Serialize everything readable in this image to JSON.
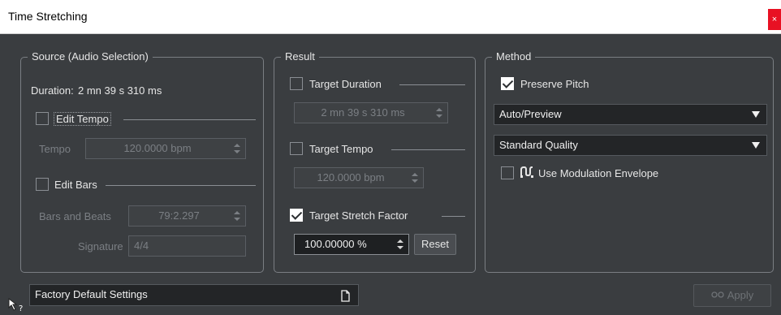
{
  "window": {
    "title": "Time Stretching",
    "close_label": "×"
  },
  "source": {
    "legend": "Source (Audio Selection)",
    "duration_label": "Duration:",
    "duration_value": "2 mn 39 s 310 ms",
    "edit_tempo": {
      "label": "Edit Tempo",
      "checked": false
    },
    "tempo": {
      "label": "Tempo",
      "value": "120.0000 bpm"
    },
    "edit_bars": {
      "label": "Edit Bars",
      "checked": false
    },
    "bars_and_beats": {
      "label": "Bars and Beats",
      "value": "79:2.297"
    },
    "signature": {
      "label": "Signature",
      "value": "4/4"
    }
  },
  "result": {
    "legend": "Result",
    "target_duration": {
      "label": "Target Duration",
      "checked": false,
      "value": "2 mn 39 s 310 ms"
    },
    "target_tempo": {
      "label": "Target Tempo",
      "checked": false,
      "value": "120.0000 bpm"
    },
    "target_stretch": {
      "label": "Target Stretch Factor",
      "checked": true,
      "value": "100.00000 %"
    },
    "reset_label": "Reset"
  },
  "method": {
    "legend": "Method",
    "preserve_pitch": {
      "label": "Preserve Pitch",
      "checked": true
    },
    "mode_select": "Auto/Preview",
    "quality_select": "Standard Quality",
    "modulation": {
      "label": "Use Modulation Envelope",
      "checked": false
    }
  },
  "footer": {
    "preset": "Factory Default Settings",
    "apply_label": "Apply"
  },
  "colors": {
    "background": "#3a3d40",
    "close": "#e81123",
    "field_active": "#1e2022"
  }
}
